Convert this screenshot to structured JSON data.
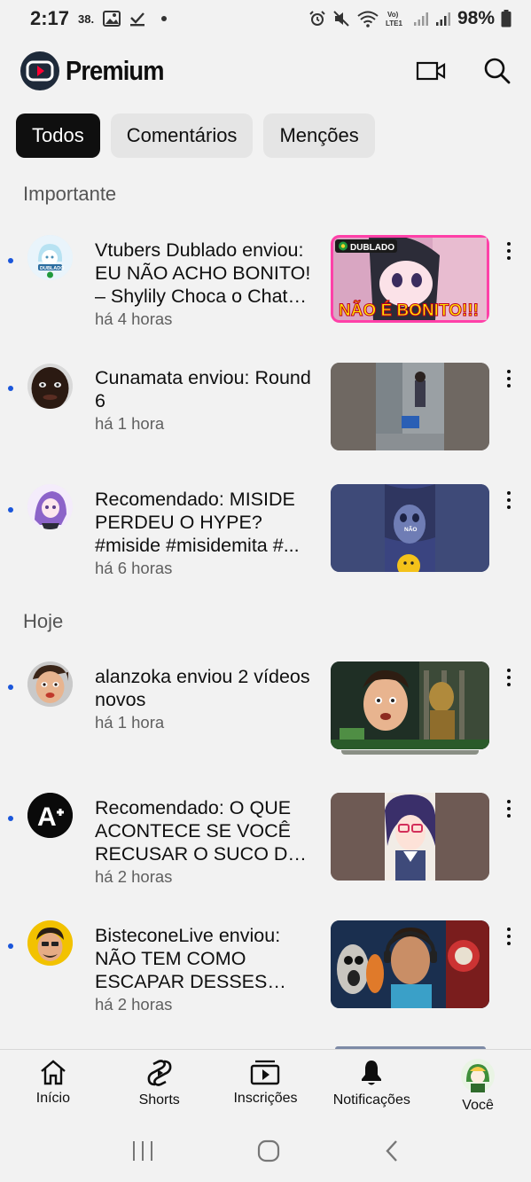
{
  "status": {
    "time": "2:17",
    "small": "38.",
    "battery": "98%"
  },
  "header": {
    "logo_text": "Premium"
  },
  "chips": [
    {
      "label": "Todos"
    },
    {
      "label": "Comentários"
    },
    {
      "label": "Menções"
    }
  ],
  "sections": {
    "important": "Importante",
    "today": "Hoje"
  },
  "notifications": [
    {
      "title": "Vtubers Dublado  enviou: EU NÃO ACHO BONITO! – Shylily Choca o Chat co...",
      "time": "há 4 horas",
      "thumb_badge": "DUBLADO",
      "thumb_text": "NÃO É BONITO!!!"
    },
    {
      "title": "Cunamata enviou: Round 6",
      "time": "há 1 hora"
    },
    {
      "title": "Recomendado: MISIDE PERDEU O HYPE? #miside #misidemita #...",
      "time": "há 6 horas",
      "thumb_text": "NÃO"
    },
    {
      "title": "alanzoka enviou 2 vídeos novos",
      "time": "há 1 hora"
    },
    {
      "title": "Recomendado: O QUE ACONTECE SE VOCÊ RECUSAR O SUCO DA ...",
      "time": "há 2 horas"
    },
    {
      "title": "BisteconeLive enviou: NÃO TEM COMO ESCAPAR DESSES MON...",
      "time": "há 2 horas"
    }
  ],
  "avatar_texts": {
    "dublado": "DUBLADO",
    "ae": "A"
  },
  "nav": [
    {
      "label": "Início"
    },
    {
      "label": "Shorts"
    },
    {
      "label": "Inscrições"
    },
    {
      "label": "Notificações"
    },
    {
      "label": "Você"
    }
  ]
}
